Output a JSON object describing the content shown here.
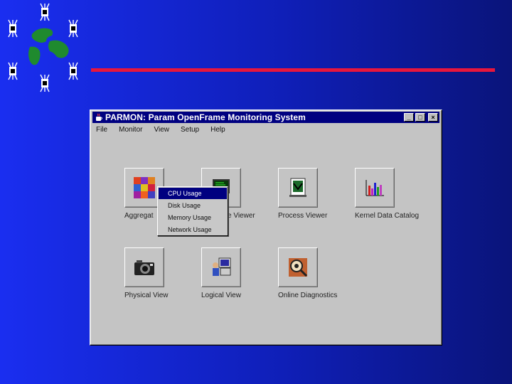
{
  "window": {
    "title": "PARMON: Param OpenFrame Monitoring System",
    "minimize_glyph": "_",
    "maximize_glyph": "□",
    "close_glyph": "×"
  },
  "menubar": [
    "File",
    "Monitor",
    "View",
    "Setup",
    "Help"
  ],
  "tiles": [
    {
      "label": "Aggregat",
      "icon": "aggregate-grid-icon"
    },
    {
      "label": "e Viewer",
      "icon": "monitor-screen-icon"
    },
    {
      "label": "Process Viewer",
      "icon": "process-viewer-icon"
    },
    {
      "label": "Kernel Data Catalog",
      "icon": "bar-chart-icon"
    },
    {
      "label": "Physical View",
      "icon": "camera-icon"
    },
    {
      "label": "Logical View",
      "icon": "computer-user-icon"
    },
    {
      "label": "Online Diagnostics",
      "icon": "magnifier-icon"
    }
  ],
  "popup_menu": [
    "CPU Usage",
    "Disk Usage",
    "Memory Usage",
    "Network Usage"
  ],
  "popup_selected_index": 0,
  "colors": {
    "background_left": "#1a2ef0",
    "background_right": "#0a147a",
    "rule": "#e8163c",
    "titlebar": "#000080",
    "logo_green": "#1f8a2e"
  }
}
